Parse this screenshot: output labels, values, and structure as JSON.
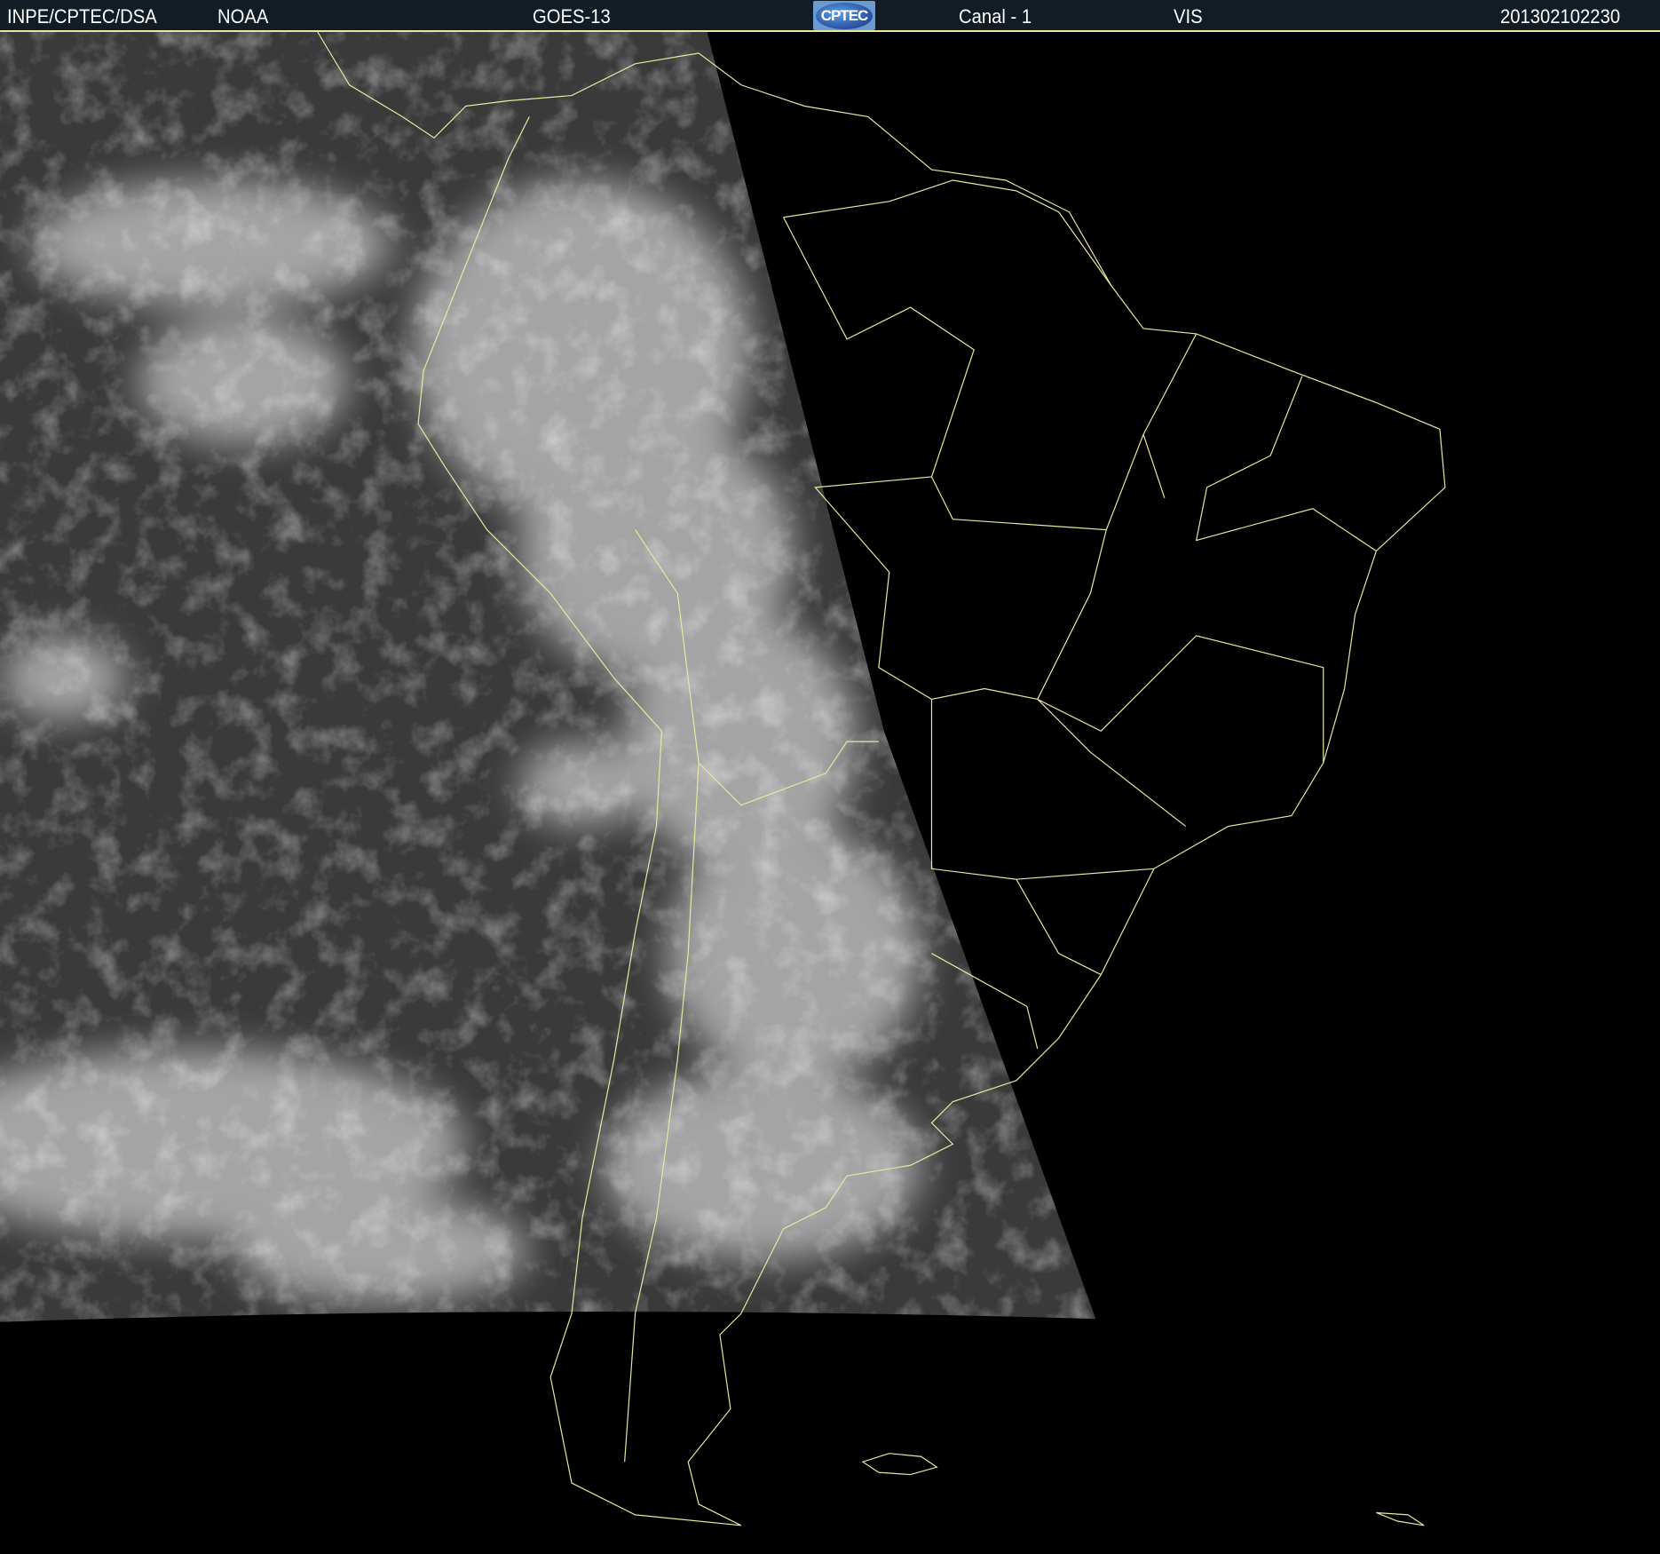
{
  "header": {
    "institution": "INPE/CPTEC/DSA",
    "agency": "NOAA",
    "satellite": "GOES-13",
    "logo_text": "CPTEC",
    "channel": "Canal - 1",
    "band": "VIS",
    "timestamp": "201302102230"
  },
  "colors": {
    "header_bg": "#121c24",
    "coastline": "#e8e8a0",
    "background": "#000000"
  }
}
